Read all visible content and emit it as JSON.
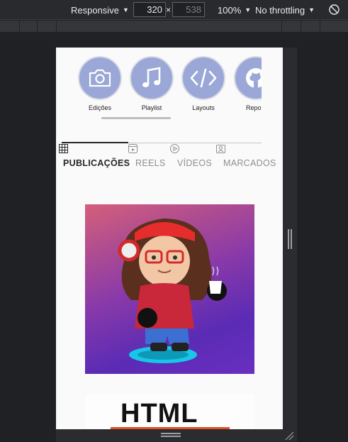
{
  "devtools": {
    "device": "Responsive",
    "width": "320",
    "times": "×",
    "height": "538",
    "zoom": "100%",
    "throttling": "No throttling"
  },
  "highlights": [
    {
      "label": "Edições",
      "icon": "camera-icon"
    },
    {
      "label": "Playlist",
      "icon": "music-note-icon"
    },
    {
      "label": "Layouts",
      "icon": "code-icon"
    },
    {
      "label": "Reposi",
      "icon": "github-icon"
    }
  ],
  "tabs": [
    {
      "label": "PUBLICAÇÕES",
      "icon": "grid-icon",
      "active": true
    },
    {
      "label": "REELS",
      "icon": "reels-icon",
      "active": false
    },
    {
      "label": "VÍDEOS",
      "icon": "play-icon",
      "active": false
    },
    {
      "label": "MARCADOS",
      "icon": "tagged-icon",
      "active": false
    }
  ],
  "posts": [
    {
      "kind": "avatar-illustration"
    },
    {
      "kind": "html-logo",
      "text": "HTML"
    }
  ],
  "colors": {
    "highlight_circle": "#9aa7d7",
    "post_gradient_start": "#d45f7a",
    "post_gradient_end": "#6a2fc0",
    "devtools_bg": "#202124"
  }
}
